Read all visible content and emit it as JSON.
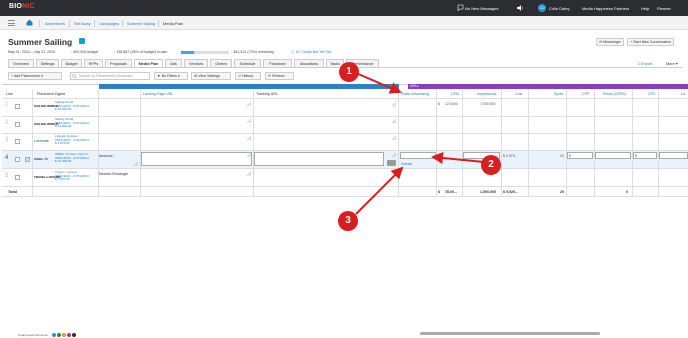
{
  "topbar": {
    "logo_main": "BIO",
    "logo_accent": "NIC",
    "messages": "No New Messages",
    "avatar_initials": "CD",
    "user_name": "Colin Daley",
    "org": "Media Happiness Partners",
    "help": "Help",
    "planner": "Planner"
  },
  "breadcrumbs": [
    "Advertisers",
    "Set Away",
    "Campaigns",
    "Summer Sailing",
    "Media Plan"
  ],
  "page": {
    "title": "Summer Sailing",
    "dates": "May 01, 2024 – July 31, 2024",
    "budget": "500,000 budget",
    "in_plan": "138,687 (28% of budget) in plan",
    "remaining": "361,313 (72%) remaining",
    "io_status": "IO / Goals Not Yet Set",
    "budget_fraction": 0.28,
    "messenger_btn": "Messenger",
    "conversation_btn": "Start New Conversation"
  },
  "tabs": [
    "Overview",
    "Settings",
    "Budget",
    "RFPs",
    "Proposals",
    "Media Plan",
    "Ads",
    "Vendors",
    "Orders",
    "Schedule",
    "Flowchart",
    "Allocations",
    "Tasks",
    "Performance"
  ],
  "active_tab": "Media Plan",
  "actions": {
    "export": "Export",
    "more": "More",
    "add_placements": "Add Placements",
    "search_placeholder": "Search by Placement/Companion",
    "filters": "No Filters",
    "view_settings": "View Settings",
    "history": "History",
    "refresh": "Refresh"
  },
  "purple_header": "40% ▸",
  "columns": {
    "line": "Line",
    "digest": "Placement Digest",
    "landing": "Landing Page URL",
    "tracking": "Tracking URL",
    "radio": "Radio Advertising",
    "cpm": "CPM",
    "impressions": "Impressions",
    "cost": "Cost",
    "spots": "Spots",
    "cpp": "CPP",
    "points": "Points (GRPs)",
    "cpc": "CPC",
    "last": "La"
  },
  "rows": [
    {
      "num": "1",
      "vendor": "SAILING WORLD",
      "name": "Sailing World",
      "dates": "05/01/2024 - 07/31/2024",
      "cost": "$ 83,400.00",
      "radio": "$",
      "cpm": "12.0000",
      "impressions": "7,000,000"
    },
    {
      "num": "2",
      "vendor": "SAILING WORLD",
      "name": "Sailing World",
      "dates": "05/01/2024 - 07/31/2024",
      "cost": "$ 24,000.00"
    },
    {
      "num": "3",
      "vendor": "LATITUDE",
      "name": "Latitude Outdoor",
      "dates": "05/01/2024 - 07/31/2024",
      "cost": "$ 4,875.00"
    },
    {
      "num": "4",
      "vendor": "WBBC-TV",
      "name": "WBBC-TV New York NY",
      "dates": "05/01/2024 - 07/31/2024",
      "cost": "$ 19,350.00",
      "extra": "America /",
      "cost_col": "$ 2,975...",
      "spots": "20"
    },
    {
      "num": "5",
      "vendor": "TRAVEL+LEISURE",
      "name": "Travel + Leisure",
      "dates": "05/01/2024 - 07/31/2024",
      "cost": "$ 7,847.00",
      "extra": "Medium Rectangle"
    }
  ],
  "row4_inputs": {
    "cpp": "$",
    "cpc": "$",
    "include": "Include"
  },
  "total": {
    "label": "Total",
    "radio": "$",
    "cpm": "78.00...",
    "impressions": "1,500,000",
    "cost": "$ 5,925...",
    "spots": "20",
    "points": "0"
  },
  "legend_label": "Unapproved line items",
  "callouts": [
    "1",
    "2",
    "3"
  ],
  "colors": {
    "topbar": "#2b2d33",
    "accent_blue": "#1d7fc4",
    "purple": "#8a3dbd",
    "callout_red": "#d81e1e"
  }
}
